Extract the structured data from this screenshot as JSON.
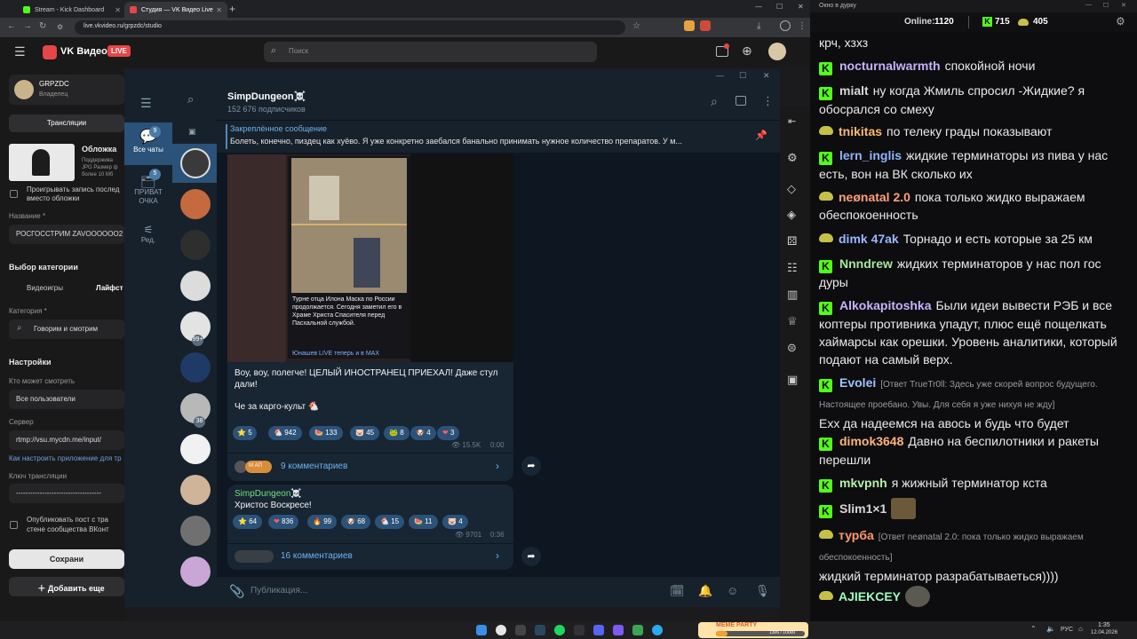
{
  "browser": {
    "tabs": [
      {
        "title": "Stream - Kick Dashboard"
      },
      {
        "title": "Студия — VK Видео Live"
      }
    ],
    "url": "live.vkvideo.ru/grpzdc/studio"
  },
  "vk": {
    "brand": "VK Видео",
    "live_badge": "LIVE",
    "search_placeholder": "Поиск",
    "channel_name": "GRPZDC",
    "channel_role": "Владелец",
    "tab_broadcasts": "Трансляции",
    "cover_title": "Обложка",
    "cover_hint": "Поддержива JPG Размер ф более 10 Мб",
    "play_record_label": "Проигрывать запись послед вместо обложки",
    "name_label": "Название *",
    "name_value": "РОСГОССТРИМ ZAVOOOOOO2",
    "category_head": "Выбор категории",
    "cat_games": "Видеоигры",
    "cat_life": "Лайфст",
    "category_label": "Категория *",
    "category_value": "Говорим и смотрим",
    "settings_head": "Настройки",
    "who_can_watch_label": "Кто может смотреть",
    "who_can_watch_value": "Все пользователи",
    "server_label": "Сервер",
    "server_value": "rtmp://vsu.mycdn.me/input/",
    "setup_link": "Как настроить приложение для тр",
    "key_label": "Ключ трансляции",
    "key_value": "------------------------------------",
    "publish_label": "Опубликовать пост с тра стене сообщества ВКонт",
    "save_button": "Сохрани",
    "add_button": "Добавить еще"
  },
  "telegram": {
    "channel_title": "SimpDungeon☠️",
    "subscribers": "152 676 подписчиков",
    "pinned_title": "Закреплённое сообщение",
    "pinned_text": "Болеть, конечно, пиздец как хуёво. Я уже конкретно заебался банально принимать нужное количество препаратов. У м...",
    "folders": [
      {
        "label": "Все чаты",
        "badge": "9"
      },
      {
        "label": "ПРИВАТ ОЧКА",
        "badge": "5"
      },
      {
        "label": "Ред.",
        "badge": ""
      }
    ],
    "chat_badges": {
      "c5": "99+",
      "c7": "38"
    },
    "post1": {
      "image_caption": "Турне отца Илона Маска по России продолжается. Сегодня заметил его в Храме Христа Спасителя перед Пасхальной службой.",
      "image_footer": "Юнашев LIVE теперь и в MAX",
      "text1": "Воу, воу, полегче! ЦЕЛЫЙ ИНОСТРАНЕЦ ПРИЕХАЛ! Даже стул дали!",
      "text2": "Че за карго-культ 🐔",
      "reactions": [
        {
          "emoji": "⭐",
          "count": "5"
        },
        {
          "emoji": "🐔",
          "count": "942"
        },
        {
          "emoji": "🍉",
          "count": "133"
        },
        {
          "emoji": "🐷",
          "count": "45"
        },
        {
          "emoji": "🐸",
          "count": "8"
        },
        {
          "emoji": "🐶",
          "count": "4"
        },
        {
          "emoji": "❤",
          "count": "3"
        }
      ],
      "views": "15.5K",
      "time": "0:00",
      "avatars_text": "М АП",
      "comments": "9 комментариев"
    },
    "post2": {
      "author": "SimpDungeon☠️",
      "text": "Христос Воскресе!",
      "reactions": [
        {
          "emoji": "⭐",
          "count": "64"
        },
        {
          "emoji": "❤",
          "count": "836"
        },
        {
          "emoji": "🔥",
          "count": "99"
        },
        {
          "emoji": "🐶",
          "count": "68"
        },
        {
          "emoji": "🐔",
          "count": "15"
        },
        {
          "emoji": "🍉",
          "count": "11"
        },
        {
          "emoji": "🐷",
          "count": "4"
        }
      ],
      "views": "9701",
      "time": "0:36",
      "comments": "16 комментариев"
    },
    "compose_placeholder": "Публикация..."
  },
  "chat": {
    "window_title": "Окно в дурку",
    "online_label": "Online:",
    "online_count": "1120",
    "kick_count": "715",
    "frog_count": "405",
    "messages": [
      {
        "badge": "none",
        "nick": "",
        "nick_color": "#eaeaea",
        "reply": "",
        "text": "крч, хзхз"
      },
      {
        "badge": "kick",
        "nick": "nocturnalwarmth",
        "nick_color": "#c6b3ff",
        "reply": "",
        "text": "спокойной ночи"
      },
      {
        "badge": "kick",
        "nick": "mialt",
        "nick_color": "#d8d8d8",
        "reply": "",
        "text": "ну когда Жмиль спросил -Жидкие? я обосрался со смеху"
      },
      {
        "badge": "frog",
        "nick": "tnikitas",
        "nick_color": "#ffb96b",
        "reply": "",
        "text": "по телеку грады показывают"
      },
      {
        "badge": "kick",
        "nick": "lern_inglis",
        "nick_color": "#8fb4ff",
        "reply": "",
        "text": "жидкие терминаторы из пива у нас есть, вон на ВК сколько их"
      },
      {
        "badge": "frog",
        "nick": "neønatal 2.0",
        "nick_color": "#ff9f7a",
        "reply": "",
        "text": "пока только жидко выражаем обеспокоенность"
      },
      {
        "badge": "frog",
        "nick": "dimk 47ak",
        "nick_color": "#9ab8ff",
        "reply": "",
        "text": "Торнадо и есть которые за 25 км"
      },
      {
        "badge": "kick",
        "nick": "Nnndrew",
        "nick_color": "#a8e6a0",
        "reply": "",
        "text": "жидких терминаторов у нас пол гос дуры"
      },
      {
        "badge": "kick",
        "nick": "Alkokapitoshka",
        "nick_color": "#c6b3ff",
        "reply": "",
        "text": "Были идеи вывести РЭБ и все коптеры противника упадут, плюс ещё пощелкать хаймарсы как орешки. Уровень аналитики, который подают на самый верх."
      },
      {
        "badge": "kick",
        "nick": "Evolei",
        "nick_color": "#a0c4ff",
        "reply": "[Ответ TrueTr0ll: Здесь уже скорей вопрос будущего. Настоящее проебано. Увы. Для себя я уже нихуя не жду]",
        "text": "Ехх да надеемся на авось и будь что будет"
      },
      {
        "badge": "kick",
        "nick": "dimok3648",
        "nick_color": "#ffb47a",
        "reply": "",
        "text": "Давно на беспилотники и ракеты перешли"
      },
      {
        "badge": "kick",
        "nick": "mkvpnh",
        "nick_color": "#b5f0a8",
        "reply": "",
        "text": "я жижный терминатор кста"
      },
      {
        "badge": "kick",
        "nick": "Slim1×1",
        "nick_color": "#d8d8d8",
        "reply": "",
        "text": ""
      },
      {
        "badge": "frog",
        "nick": "турба",
        "nick_color": "#ff9a6b",
        "reply": "[Ответ neønatal 2.0: пока только жидко выражаем обеспокоенность]",
        "text": "жидкий терминатор разрабатываеться))))"
      },
      {
        "badge": "frog",
        "nick": "AJIEKCEY",
        "nick_color": "#9affc0",
        "reply": "",
        "text": ""
      }
    ]
  },
  "taskbar": {
    "language": "РУС",
    "time": "1:35",
    "date": "12.04.2026",
    "widget_title": "MEME PARTY",
    "widget_progress": "1306 / 10000"
  },
  "colors": {
    "kick_green": "#53fc18",
    "telegram_bg": "#0e1621",
    "telegram_panel": "#17212b",
    "telegram_accent": "#2b5278",
    "vk_red": "#e64646"
  }
}
